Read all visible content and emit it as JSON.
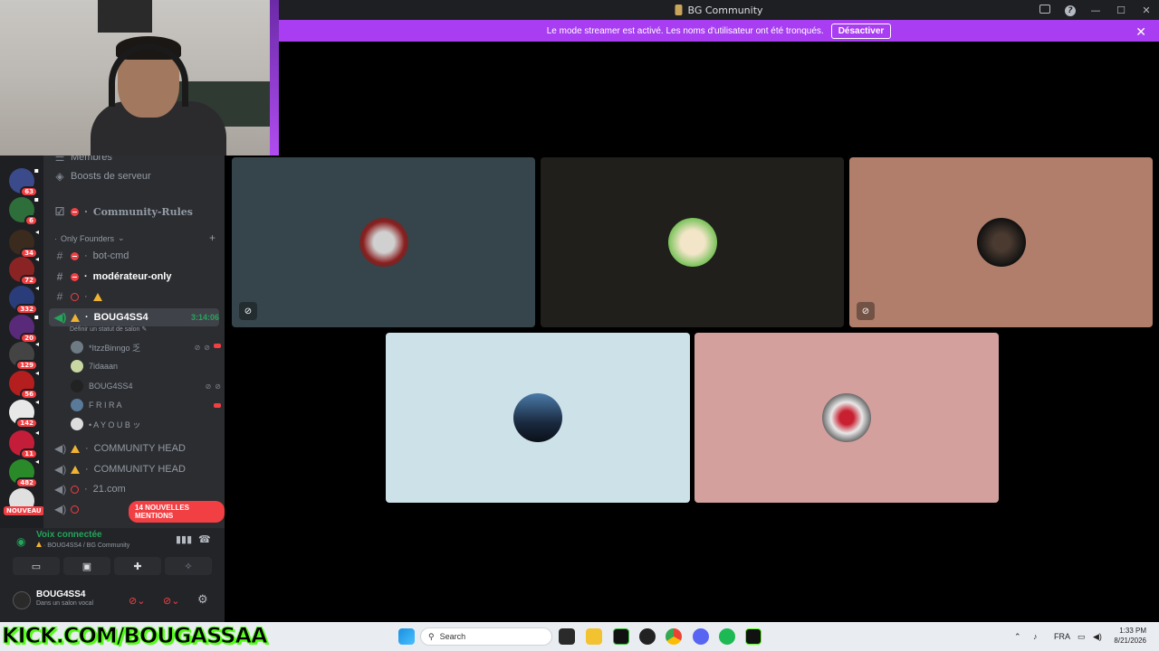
{
  "window": {
    "title": "BG Community"
  },
  "banner": {
    "text": "Le mode streamer est activé. Les noms d'utilisateur ont été tronqués.",
    "button": "Désactiver",
    "close": "✕"
  },
  "servers": {
    "badges": [
      "63",
      "6",
      "",
      "34",
      "72",
      "332",
      "20",
      "129",
      "56",
      "142",
      "11",
      "482",
      ""
    ],
    "new_label": "NOUVEAU"
  },
  "channels": {
    "top_partial": "Membres",
    "boosts": "Boosts de serveur",
    "rules": "Community-Rules",
    "category": "Only Founders",
    "items": [
      {
        "name": "bot-cmd"
      },
      {
        "name": "modérateur-only"
      },
      {
        "name": ""
      }
    ],
    "voice_active": {
      "name": "BOUG4SS4",
      "timer": "3:14:06",
      "status": "Définir un statut de salon"
    },
    "voice_users": [
      {
        "name": "*ItzzBinngo 乏"
      },
      {
        "name": "7idaaan"
      },
      {
        "name": "BOUG4SS4"
      },
      {
        "name": "F R I R A"
      },
      {
        "name": "• A Y O U B ッ"
      }
    ],
    "voice_channels": [
      {
        "name": "COMMUNITY HEAD"
      },
      {
        "name": "COMMUNITY HEAD"
      },
      {
        "name": "21.com"
      }
    ],
    "mentions": "14 NOUVELLES MENTIONS"
  },
  "voice_panel": {
    "title": "Voix connectée",
    "subtitle": "BOUG4SS4 / BG Community",
    "user": "BOUG4SS4",
    "status": "Dans un salon vocal"
  },
  "tiles": [
    {
      "name": "tile-1",
      "bg": "#36454b"
    },
    {
      "name": "tile-2",
      "bg": "#201f1c"
    },
    {
      "name": "tile-3",
      "bg": "#b07e6a"
    },
    {
      "name": "tile-4",
      "bg": "#cde1e8"
    },
    {
      "name": "tile-5",
      "bg": "#d3a09e"
    }
  ],
  "taskbar": {
    "kick": "KICK.COM/BOUGASSAA",
    "search": "Search",
    "lang": "FRA",
    "time": "1:33 PM",
    "date": "8/21/2026"
  }
}
